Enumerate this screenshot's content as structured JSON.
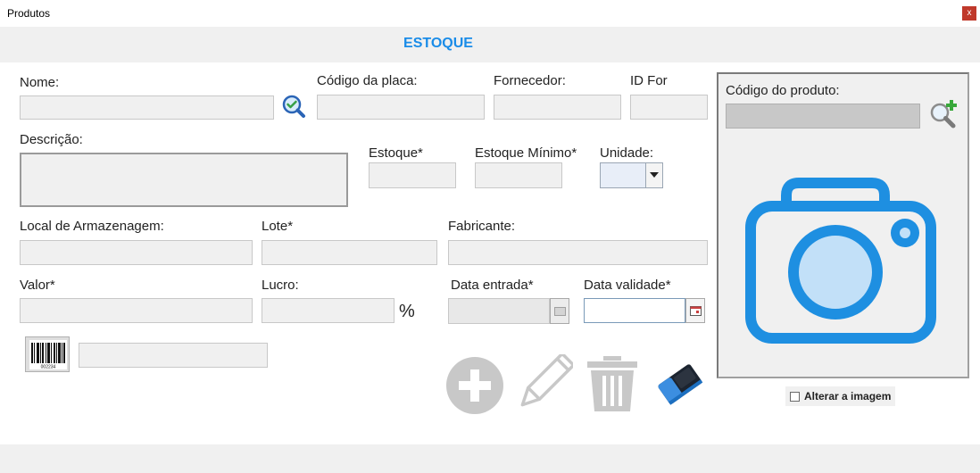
{
  "window": {
    "title": "Produtos",
    "close_label": "x"
  },
  "header": {
    "title": "ESTOQUE"
  },
  "form": {
    "nome_label": "Nome:",
    "codigo_placa_label": "Código da placa:",
    "fornecedor_label": "Fornecedor:",
    "id_for_label": "ID For",
    "descricao_label": "Descrição:",
    "estoque_label": "Estoque*",
    "estoque_minimo_label": "Estoque Mínimo*",
    "unidade_label": "Unidade:",
    "local_label": "Local de Armazenagem:",
    "lote_label": "Lote*",
    "fabricante_label": "Fabricante:",
    "valor_label": "Valor*",
    "lucro_label": "Lucro:",
    "percent_symbol": "%",
    "data_entrada_label": "Data entrada*",
    "data_validade_label": "Data validade*"
  },
  "photo_panel": {
    "codigo_produto_label": "Código do produto:"
  },
  "checkbox": {
    "label": "Alterar a imagem",
    "checked": false
  },
  "icons": {
    "search": "search-check-icon",
    "zoom_add": "zoom-add-icon",
    "barcode": "barcode-icon",
    "camera": "camera-icon",
    "add": "add-icon",
    "edit": "pencil-icon",
    "delete": "trash-icon",
    "clear": "eraser-icon"
  },
  "colors": {
    "accent": "#1a8ce8",
    "camera": "#1e8fe1",
    "camera_lens": "#c2e0f8",
    "disabled_icon": "#c8c8c8"
  },
  "barcode_number": "002234"
}
